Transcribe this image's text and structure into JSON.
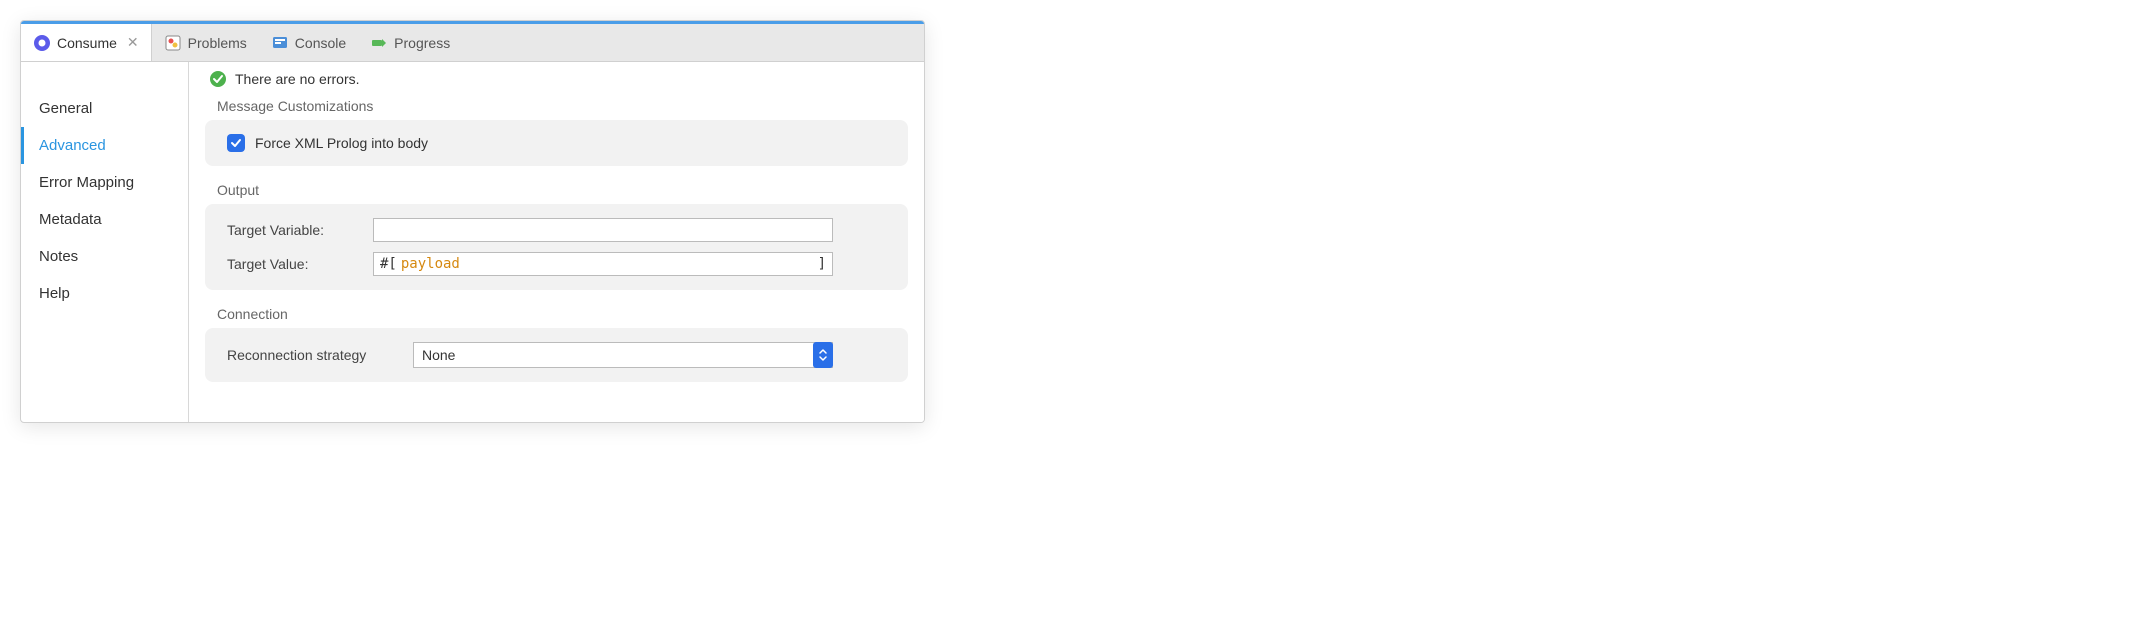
{
  "tabs": [
    {
      "label": "Consume",
      "active": true
    },
    {
      "label": "Problems",
      "active": false
    },
    {
      "label": "Console",
      "active": false
    },
    {
      "label": "Progress",
      "active": false
    }
  ],
  "sidebar": {
    "items": [
      {
        "label": "General",
        "active": false
      },
      {
        "label": "Advanced",
        "active": true
      },
      {
        "label": "Error Mapping",
        "active": false
      },
      {
        "label": "Metadata",
        "active": false
      },
      {
        "label": "Notes",
        "active": false
      },
      {
        "label": "Help",
        "active": false
      }
    ]
  },
  "status": {
    "text": "There are no errors."
  },
  "sections": {
    "message_customizations": {
      "title": "Message Customizations",
      "force_xml_label": "Force XML Prolog into body",
      "force_xml_checked": true
    },
    "output": {
      "title": "Output",
      "target_variable_label": "Target Variable:",
      "target_variable_value": "",
      "target_value_label": "Target Value:",
      "target_value_prefix": "#[",
      "target_value_payload": "payload",
      "target_value_suffix": "]"
    },
    "connection": {
      "title": "Connection",
      "reconnection_label": "Reconnection strategy",
      "reconnection_value": "None"
    }
  }
}
